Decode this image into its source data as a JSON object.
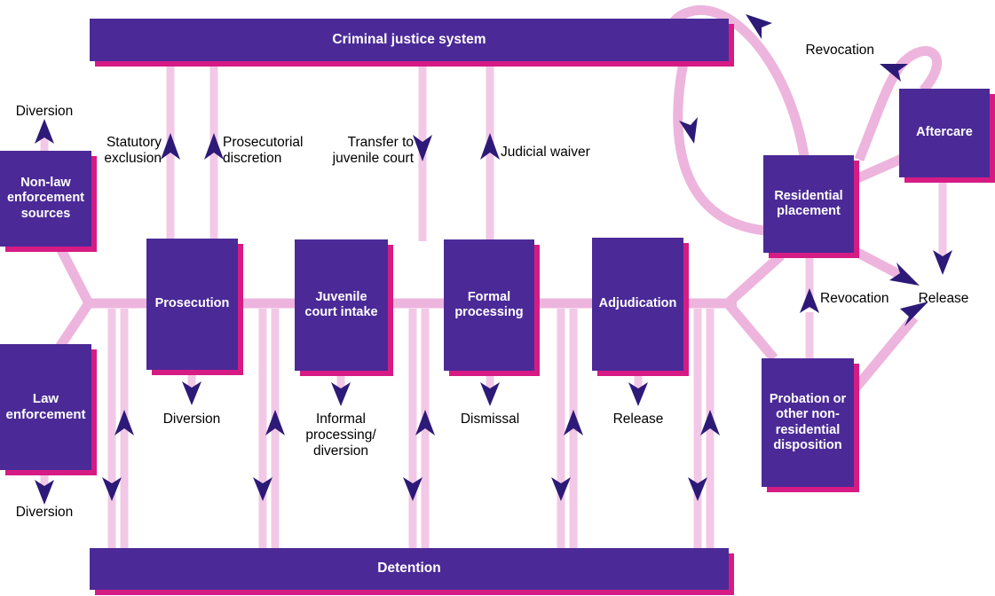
{
  "diagram": {
    "title": "Juvenile justice system case flow diagram",
    "colors": {
      "node_fill": "#4b2a97",
      "node_shadow": "#d61b84",
      "flow_line": "#edb4dd",
      "flow_line_light": "#f2c8e6",
      "arrow_head": "#2d1a78",
      "node_text": "#ffffff",
      "label_text": "#000000",
      "background": "#ffffff"
    },
    "nodes": [
      {
        "id": "criminal-justice-system",
        "label": "Criminal justice system"
      },
      {
        "id": "non-law-enforcement-sources",
        "label": "Non-law\nenforcement\nsources"
      },
      {
        "id": "law-enforcement",
        "label": "Law\nenforcement"
      },
      {
        "id": "prosecution",
        "label": "Prosecution"
      },
      {
        "id": "juvenile-court-intake",
        "label": "Juvenile\ncourt intake"
      },
      {
        "id": "formal-processing",
        "label": "Formal\nprocessing"
      },
      {
        "id": "adjudication",
        "label": "Adjudication"
      },
      {
        "id": "residential-placement",
        "label": "Residential\nplacement"
      },
      {
        "id": "aftercare",
        "label": "Aftercare"
      },
      {
        "id": "probation-or-other-nonresidential-disposition",
        "label": "Probation or\nother non-\nresidential\ndisposition"
      },
      {
        "id": "detention",
        "label": "Detention"
      }
    ],
    "edge_labels": [
      {
        "id": "diversion-non-law",
        "text": "Diversion"
      },
      {
        "id": "statutory-exclusion",
        "text": "Statutory\nexclusion"
      },
      {
        "id": "prosecutorial-discretion",
        "text": "Prosecutorial\ndiscretion"
      },
      {
        "id": "transfer-to-juvenile-court",
        "text": "Transfer to\njuvenile court"
      },
      {
        "id": "judicial-waiver",
        "text": "Judicial waiver"
      },
      {
        "id": "revocation-aftercare",
        "text": "Revocation"
      },
      {
        "id": "diversion-law-enforcement",
        "text": "Diversion"
      },
      {
        "id": "diversion-prosecution",
        "text": "Diversion"
      },
      {
        "id": "informal-processing-diversion",
        "text": "Informal\nprocessing/\ndiversion"
      },
      {
        "id": "dismissal",
        "text": "Dismissal"
      },
      {
        "id": "release-adjudication",
        "text": "Release"
      },
      {
        "id": "revocation-probation",
        "text": "Revocation"
      },
      {
        "id": "release-residential",
        "text": "Release"
      }
    ]
  }
}
